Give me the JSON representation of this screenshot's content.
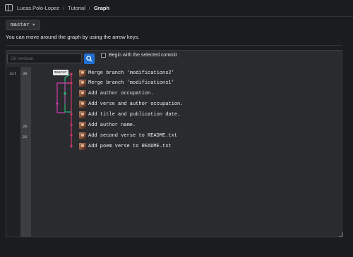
{
  "breadcrumb": {
    "items": [
      "Lucas.Polo-Lopez",
      "Tutorial",
      "Graph"
    ],
    "separator": "/"
  },
  "branch_selector": {
    "label": "master",
    "chevron_icon": "chevron-down-icon"
  },
  "hint_text": "You can move around the graph by using the arrow keys.",
  "search": {
    "placeholder": "Git revision",
    "value": "",
    "icon": "search-icon"
  },
  "begin_selected": {
    "label": "Begin with the selected commit",
    "checked": false
  },
  "graph": {
    "branch_tag": "master",
    "colors": {
      "main": "#d0376a",
      "branch_a": "#2fb57a",
      "branch_b": "#cf3fb0"
    },
    "commits": [
      {
        "date": "Jul",
        "day": "30",
        "message": "Merge branch 'modifications2'"
      },
      {
        "date": "",
        "day": "",
        "message": "Merge branch 'modifications1'"
      },
      {
        "date": "",
        "day": "",
        "message": "Add author occupation."
      },
      {
        "date": "",
        "day": "",
        "message": "Add verse and author occupation."
      },
      {
        "date": "",
        "day": "",
        "message": "Add title and publication date."
      },
      {
        "date": "",
        "day": "26",
        "message": "Add author name."
      },
      {
        "date": "",
        "day": "22",
        "message": "Add second verse to README.txt"
      },
      {
        "date": "",
        "day": "",
        "message": "Add poem verse to README.txt"
      }
    ]
  }
}
